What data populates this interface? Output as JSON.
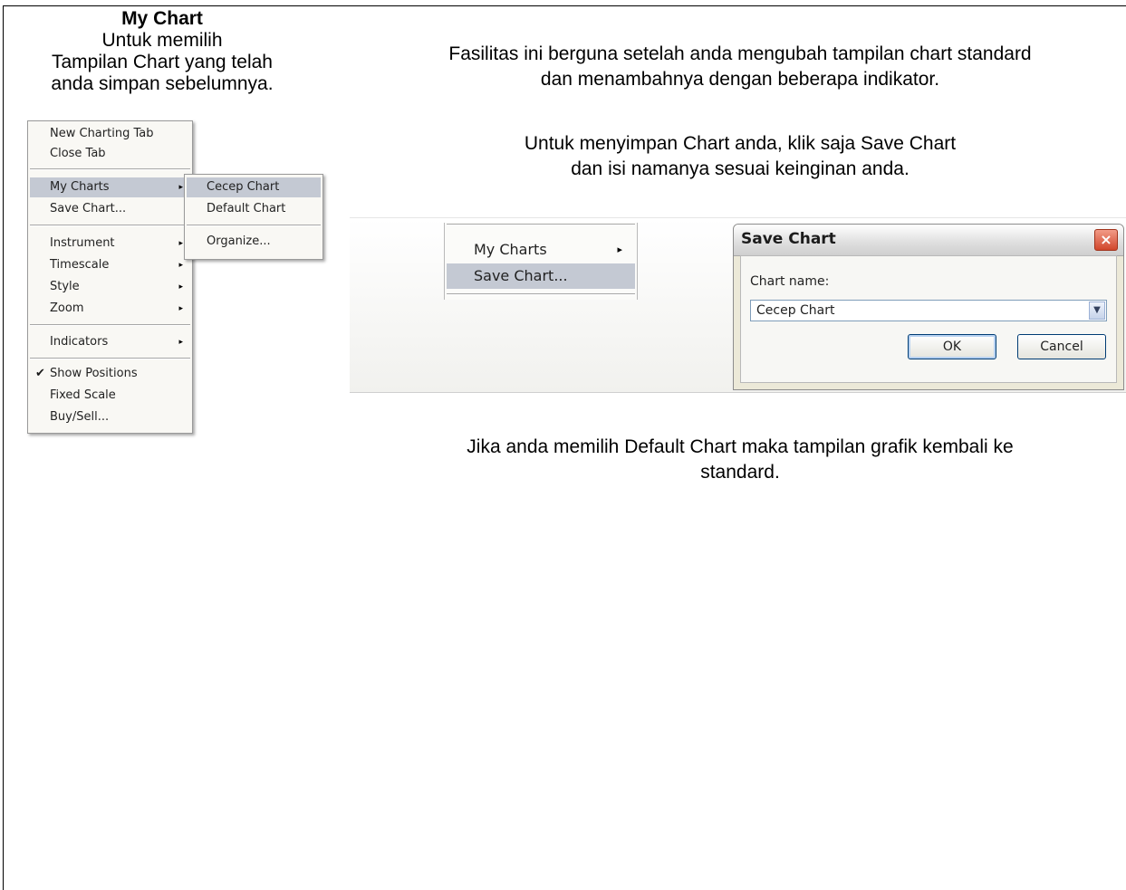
{
  "left_panel": {
    "title": "My Chart",
    "line1": "Untuk memilih",
    "line2": "Tampilan Chart yang telah",
    "line3": "anda simpan sebelumnya."
  },
  "intro": {
    "line1": "Fasilitas ini berguna setelah anda mengubah tampilan chart standard",
    "line2": "dan menambahnya dengan beberapa indikator."
  },
  "save_hint": {
    "line1": "Untuk menyimpan Chart anda, klik saja Save Chart",
    "line2": "dan isi namanya sesuai keinginan anda."
  },
  "default_note": {
    "line1": "Jika anda memilih Default Chart maka tampilan grafik kembali ke",
    "line2": "standard."
  },
  "context_menu": {
    "new_charting_tab": "New Charting Tab",
    "close_tab": "Close Tab",
    "my_charts": "My Charts",
    "save_chart": "Save Chart...",
    "instrument": "Instrument",
    "timescale": "Timescale",
    "style": "Style",
    "zoom": "Zoom",
    "indicators": "Indicators",
    "show_positions": "Show Positions",
    "fixed_scale": "Fixed Scale",
    "buy_sell": "Buy/Sell..."
  },
  "submenu": {
    "cecep_chart": "Cecep Chart",
    "default_chart": "Default Chart",
    "organize": "Organize..."
  },
  "mini_menu": {
    "my_charts": "My Charts",
    "save_chart": "Save Chart..."
  },
  "dialog": {
    "title": "Save Chart",
    "close_glyph": "×",
    "name_label": "Chart name:",
    "name_value": "Cecep Chart",
    "ok": "OK",
    "cancel": "Cancel"
  },
  "icons": {
    "submenu_arrow": "▸",
    "check": "✔",
    "dropdown": "▼"
  }
}
